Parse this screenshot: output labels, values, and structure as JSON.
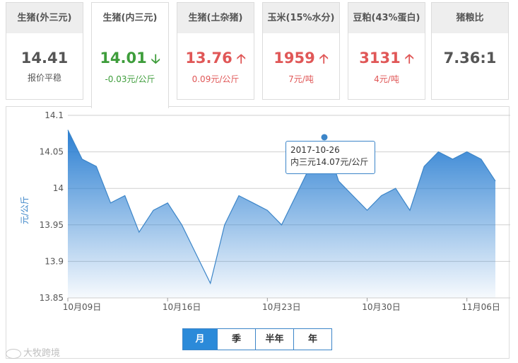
{
  "cards": [
    {
      "label": "生猪(外三元)",
      "value": "14.41",
      "value_color": "#555555",
      "arrow": "",
      "sub": "报价平稳",
      "sub_color": "#555555",
      "active": false
    },
    {
      "label": "生猪(内三元)",
      "value": "14.01",
      "value_color": "#3e9d3b",
      "arrow": "down",
      "sub": "-0.03元/公斤",
      "sub_color": "#3e9d3b",
      "active": true
    },
    {
      "label": "生猪(土杂猪)",
      "value": "13.76",
      "value_color": "#e05757",
      "arrow": "up",
      "sub": "0.09元/公斤",
      "sub_color": "#e05757",
      "active": false
    },
    {
      "label": "玉米(15%水分)",
      "value": "1959",
      "value_color": "#e05757",
      "arrow": "up",
      "sub": "7元/吨",
      "sub_color": "#e05757",
      "active": false
    },
    {
      "label": "豆粕(43%蛋白)",
      "value": "3131",
      "value_color": "#e05757",
      "arrow": "up",
      "sub": "4元/吨",
      "sub_color": "#e05757",
      "active": false
    },
    {
      "label": "猪粮比",
      "value": "7.36:1",
      "value_color": "#555555",
      "arrow": "",
      "sub": "",
      "sub_color": "#555555",
      "active": false
    }
  ],
  "chart_data": {
    "type": "area",
    "ylabel": "元/公斤",
    "ylim": [
      13.85,
      14.1
    ],
    "yticks": [
      13.85,
      13.9,
      13.95,
      14,
      14.05,
      14.1
    ],
    "xlabels": [
      "10月09日",
      "10月16日",
      "10月23日",
      "10月30日",
      "11月06日"
    ],
    "xlabel_index": [
      0,
      7,
      14,
      21,
      28
    ],
    "x": [
      "10-09",
      "10-10",
      "10-11",
      "10-12",
      "10-13",
      "10-14",
      "10-15",
      "10-16",
      "10-17",
      "10-18",
      "10-19",
      "10-20",
      "10-21",
      "10-22",
      "10-23",
      "10-24",
      "10-25",
      "10-26",
      "10-27",
      "10-28",
      "10-29",
      "10-30",
      "10-31",
      "11-01",
      "11-02",
      "11-03",
      "11-04",
      "11-05",
      "11-06",
      "11-07"
    ],
    "values": [
      14.08,
      14.04,
      14.03,
      13.98,
      13.99,
      13.94,
      13.97,
      13.98,
      13.95,
      13.91,
      13.87,
      13.95,
      13.99,
      13.98,
      13.97,
      13.95,
      13.99,
      14.03,
      14.07,
      14.01,
      13.99,
      13.97,
      13.99,
      14.0,
      13.97,
      14.03,
      14.05,
      14.04,
      14.05,
      14.04,
      14.01
    ],
    "grid": true,
    "line_color": "#3c85c8",
    "highlight_index": 18
  },
  "tooltip": {
    "date": "2017-10-26",
    "text": "内三元14.07元/公斤"
  },
  "periods": [
    {
      "label": "月",
      "active": true
    },
    {
      "label": "季",
      "active": false
    },
    {
      "label": "半年",
      "active": false
    },
    {
      "label": "年",
      "active": false
    }
  ],
  "watermark": "大牧跨境"
}
